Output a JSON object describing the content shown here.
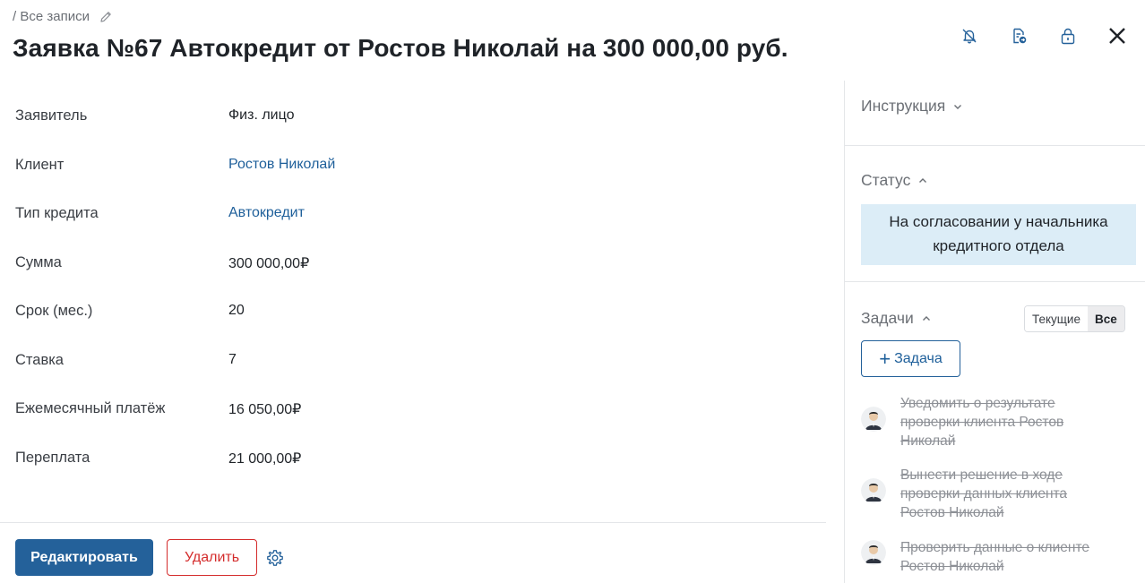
{
  "breadcrumb": {
    "text": "/ Все записи"
  },
  "title": "Заявка №67 Автокредит от Ростов Николай на 300 000,00 руб.",
  "top_icons": [
    "bell-off-icon",
    "document-share-icon",
    "lock-icon",
    "close-icon"
  ],
  "fields": [
    {
      "label": "Заявитель",
      "value": "Физ. лицо",
      "link": false
    },
    {
      "label": "Клиент",
      "value": "Ростов Николай",
      "link": true
    },
    {
      "label": "Тип кредита",
      "value": "Автокредит",
      "link": true
    },
    {
      "label": "Сумма",
      "value": "300 000,00₽",
      "link": false
    },
    {
      "label": "Срок (мес.)",
      "value": "20",
      "link": false
    },
    {
      "label": "Ставка",
      "value": "7",
      "link": false
    },
    {
      "label": "Ежемесячный платёж",
      "value": "16 050,00₽",
      "link": false
    },
    {
      "label": "Переплата",
      "value": "21 000,00₽",
      "link": false
    }
  ],
  "actions": {
    "edit_label": "Редактировать",
    "delete_label": "Удалить"
  },
  "right_panel": {
    "instruction_label": "Инструкция",
    "status_label": "Статус",
    "status_value": "На согласовании у начальника кредитного отдела",
    "tasks_label": "Задачи",
    "toggle_current": "Текущие",
    "toggle_all": "Все",
    "add_task_label": "Задача",
    "tasks": [
      {
        "text": "Уведомить о результате проверки клиента Ростов Николай"
      },
      {
        "text": "Вынести решение в ходе проверки данных клиента Ростов Николай"
      },
      {
        "text": "Проверить данные о клиенте Ростов Николай"
      }
    ]
  },
  "colors": {
    "accent": "#24619a",
    "link": "#1e5f9a",
    "danger": "#d42c2c",
    "status_bg": "#dcedf7"
  }
}
